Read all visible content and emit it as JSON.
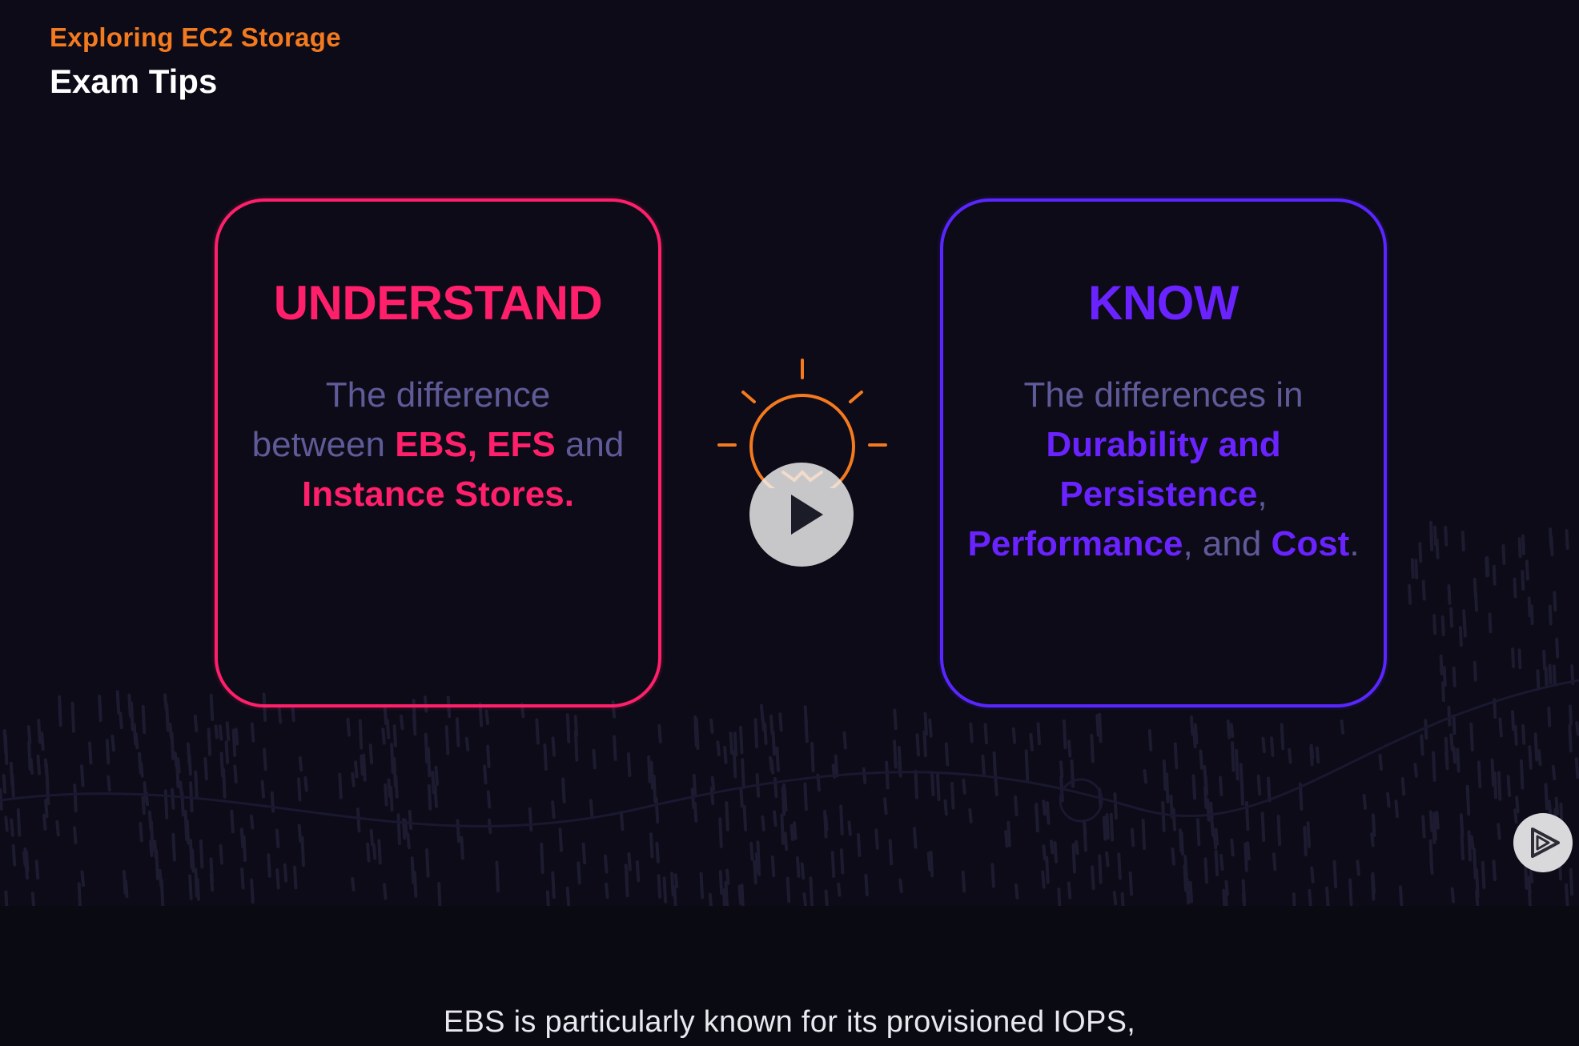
{
  "header": {
    "course_title": "Exploring EC2 Storage",
    "section_title": "Exam Tips"
  },
  "cards": {
    "understand": {
      "heading": "UNDERSTAND",
      "line1": "The difference",
      "line2_prefix": "between ",
      "line2_highlight": "EBS, EFS",
      "line2_suffix": " and",
      "line3_highlight": "Instance Stores."
    },
    "know": {
      "heading": "KNOW",
      "line1": "The differences in",
      "line2_highlight": "Durability and",
      "line3_highlight": "Persistence",
      "line3_suffix": ",",
      "line4_highlight_a": "Performance",
      "line4_mid": ", and ",
      "line4_highlight_b": "Cost",
      "line4_suffix": "."
    }
  },
  "icons": {
    "center": "lightbulb-icon",
    "play": "play-icon",
    "next": "next-icon"
  },
  "player": {
    "caption": "EBS is particularly known for its provisioned IOPS,"
  },
  "colors": {
    "accent_orange": "#f47a20",
    "understand_pink": "#ff1f6b",
    "know_purple": "#6a22ff",
    "body_text": "#5f5a98",
    "background": "#0c0b17"
  }
}
